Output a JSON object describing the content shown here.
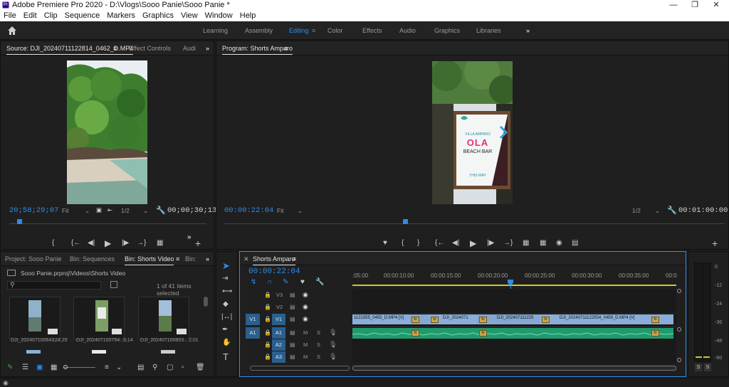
{
  "window": {
    "title": "Adobe Premiere Pro 2020 - D:\\Vlogs\\Sooo Panie\\Sooo Panie *",
    "app_icon": "Pr"
  },
  "menu": [
    "File",
    "Edit",
    "Clip",
    "Sequence",
    "Markers",
    "Graphics",
    "View",
    "Window",
    "Help"
  ],
  "workspaces": [
    "Learning",
    "Assembly",
    "Editing",
    "Color",
    "Effects",
    "Audio",
    "Graphics",
    "Libraries"
  ],
  "active_workspace": "Editing",
  "source": {
    "tabs": [
      "Source: DJI_20240711122814_0462_D.MP4",
      "Effect Controls",
      "Audi"
    ],
    "timecode": "20;58;29;07",
    "fit": "Fit",
    "resolution": "1/2",
    "duration": "00;00;30;13"
  },
  "program": {
    "tab": "Program: Shorts Amparo",
    "timecode": "00:00:22:04",
    "fit": "Fit",
    "resolution": "1/2",
    "duration": "00:01:00:00",
    "sign": {
      "brand": "VILLA AMPARO",
      "title": "OLA",
      "subtitle": "BEACH BAR",
      "direction": "THIS WAY"
    }
  },
  "project": {
    "tabs": [
      "Project: Sooo Panie",
      "Bin: Sequences",
      "Bin: Shorts Video",
      "Bin:"
    ],
    "path": "Sooo Panie.prproj\\Videos\\Shorts Video",
    "selection": "1 of 41 items selected",
    "items": [
      {
        "name": "DJI_202407100643...",
        "duration": "24;29"
      },
      {
        "name": "DJI_202407100754...",
        "duration": "9;14"
      },
      {
        "name": "DJI_202407100803...",
        "duration": "2;01"
      }
    ]
  },
  "timeline": {
    "tab": "Shorts Amparo",
    "timecode": "00:00:22:04",
    "ruler": [
      ":05:00",
      "00:00:10:00",
      "00:00:15:00",
      "00:00:20:00",
      "00:00:25:00",
      "00:00:30:00",
      "00:00:35:00",
      "00:0"
    ],
    "tracks": {
      "video": [
        "V3",
        "V2",
        "V1"
      ],
      "audio": [
        "A1",
        "A2",
        "A3"
      ],
      "source_v": "V1",
      "source_a": "A1",
      "mute": "M",
      "solo": "S"
    },
    "clips": [
      {
        "label": "1122355_0455_D.MP4 [V]"
      },
      {
        "label": "DJI_2024071"
      },
      {
        "label": "DJI_202407111225"
      },
      {
        "label": "DJI_20240711122554_0459_D.MP4 [V]"
      }
    ],
    "fx_label": "fx"
  },
  "audio_meter": {
    "scale": [
      "0",
      "-12",
      "-24",
      "-36",
      "-48",
      "-60",
      "dB"
    ],
    "solo": [
      "S",
      "S"
    ]
  },
  "colors": {
    "accent": "#2d8ceb",
    "video_clip": "#8aaed8",
    "audio_clip": "#1e9c6e",
    "playhead": "#2d8ceb",
    "work_area": "#e6d230"
  }
}
